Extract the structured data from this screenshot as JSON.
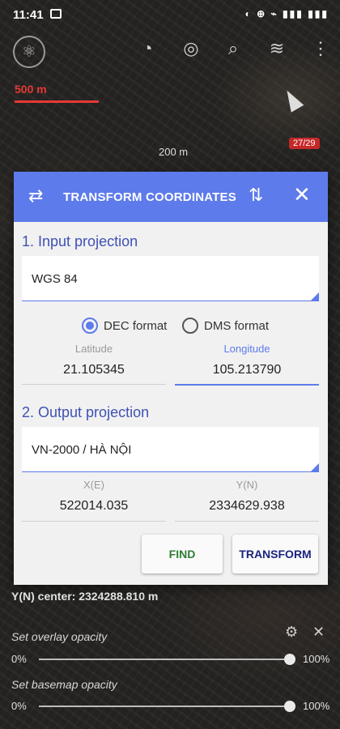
{
  "status_bar": {
    "time": "11:41",
    "right_icons": "◐ ⊕ ⌁ ▮▮▮ ▮▮▮"
  },
  "map": {
    "scale_red": "500 m",
    "scale_white": "200 m",
    "badge": "27/29",
    "toolbar_icons": [
      "layers-logo-icon",
      "gps-icon",
      "shutter-icon",
      "search-icon",
      "layers-icon",
      "more-icon"
    ]
  },
  "dialog": {
    "title": "TRANSFORM COORDINATES",
    "input": {
      "section_title": "1. Input projection",
      "projection": "WGS 84",
      "format_options": [
        {
          "label": "DEC format",
          "selected": true
        },
        {
          "label": "DMS format",
          "selected": false
        }
      ],
      "latitude_label": "Latitude",
      "latitude_value": "21.105345",
      "longitude_label": "Longitude",
      "longitude_value": "105.213790"
    },
    "output": {
      "section_title": "2. Output projection",
      "projection": "VN-2000 / HÀ NỘI",
      "x_label": "X(E)",
      "x_value": "522014.035",
      "y_label": "Y(N)",
      "y_value": "2334629.938"
    },
    "buttons": {
      "find": "FIND",
      "transform": "TRANSFORM"
    },
    "colors": {
      "header": "#5d7bea",
      "accent": "#3f51b5",
      "find_text": "#2e7d32",
      "transform_text": "#1a237e"
    }
  },
  "overlay": {
    "center_text": "Y(N) center: 2324288.810 m",
    "overlay_opacity_label": "Set overlay opacity",
    "basemap_opacity_label": "Set basemap opacity",
    "min_label": "0%",
    "max_label": "100%",
    "overlay_opacity_value": 1.0,
    "basemap_opacity_value": 1.0
  }
}
